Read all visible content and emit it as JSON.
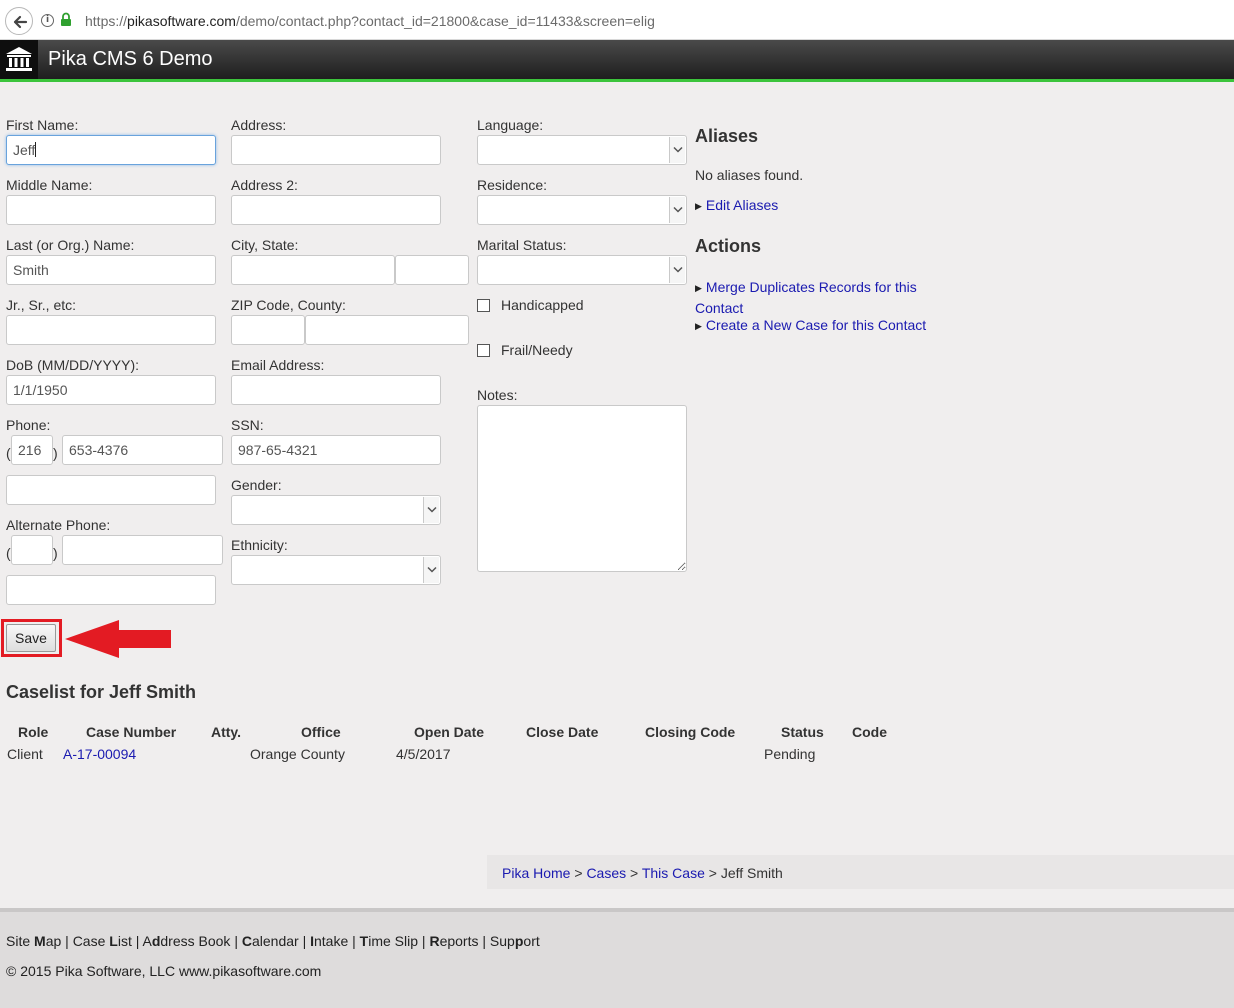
{
  "browser": {
    "url_scheme": "https://",
    "url_host": "pikasoftware.com",
    "url_path": "/demo/contact.php?contact_id=21800&case_id=11433&screen=elig"
  },
  "app": {
    "title": "Pika CMS 6 Demo",
    "accent_color": "#3cc43c"
  },
  "form": {
    "first_name_label": "First Name:",
    "first_name_value": "Jeff",
    "middle_name_label": "Middle Name:",
    "last_name_label": "Last (or Org.) Name:",
    "last_name_value": "Smith",
    "suffix_label": "Jr., Sr., etc:",
    "dob_label": "DoB (MM/DD/YYYY):",
    "dob_value": "1/1/1950",
    "phone_label": "Phone:",
    "phone_area": "216",
    "phone_number": "653-4376",
    "alt_phone_label": "Alternate Phone:",
    "address_label": "Address:",
    "address2_label": "Address 2:",
    "city_state_label": "City, State:",
    "zip_county_label": "ZIP Code, County:",
    "email_label": "Email Address:",
    "ssn_label": "SSN:",
    "ssn_value": "987-65-4321",
    "gender_label": "Gender:",
    "ethnicity_label": "Ethnicity:",
    "language_label": "Language:",
    "residence_label": "Residence:",
    "marital_label": "Marital Status:",
    "handicapped_label": "Handicapped",
    "frail_label": "Frail/Needy",
    "notes_label": "Notes:",
    "paren_open": "(",
    "paren_close": ")",
    "save_label": "Save"
  },
  "sidebar": {
    "aliases_title": "Aliases",
    "no_aliases": "No aliases found.",
    "edit_aliases": "Edit Aliases",
    "actions_title": "Actions",
    "merge_line1": "Merge Duplicates Records for this",
    "merge_line2": "Contact",
    "create_case": "Create a New Case for this Contact"
  },
  "caselist": {
    "title": "Caselist for Jeff Smith",
    "headers": [
      "Role",
      "Case Number",
      "Atty.",
      "Office",
      "Open Date",
      "Close Date",
      "Closing Code",
      "Status",
      "Code"
    ],
    "rows": [
      {
        "role": "Client",
        "case_number": "A-17-00094",
        "atty": "",
        "office": "Orange County",
        "open_date": "4/5/2017",
        "close_date": "",
        "closing_code": "",
        "status": "Pending",
        "code": ""
      }
    ]
  },
  "breadcrumb": {
    "home": "Pika Home",
    "cases": "Cases",
    "this_case": "This Case",
    "current": "Jeff Smith",
    "separator": ">"
  },
  "footer": {
    "nav": [
      {
        "pre": "Site ",
        "key": "M",
        "post": "ap"
      },
      {
        "pre": "Case ",
        "key": "L",
        "post": "ist"
      },
      {
        "pre": "A",
        "key": "d",
        "post": "dress Book"
      },
      {
        "pre": "",
        "key": "C",
        "post": "alendar"
      },
      {
        "pre": "",
        "key": "I",
        "post": "ntake"
      },
      {
        "pre": "",
        "key": "T",
        "post": "ime Slip"
      },
      {
        "pre": "",
        "key": "R",
        "post": "eports"
      },
      {
        "pre": "Sup",
        "key": "p",
        "post": "ort"
      }
    ],
    "copyright": "© 2015 Pika Software, LLC www.pikasoftware.com"
  }
}
